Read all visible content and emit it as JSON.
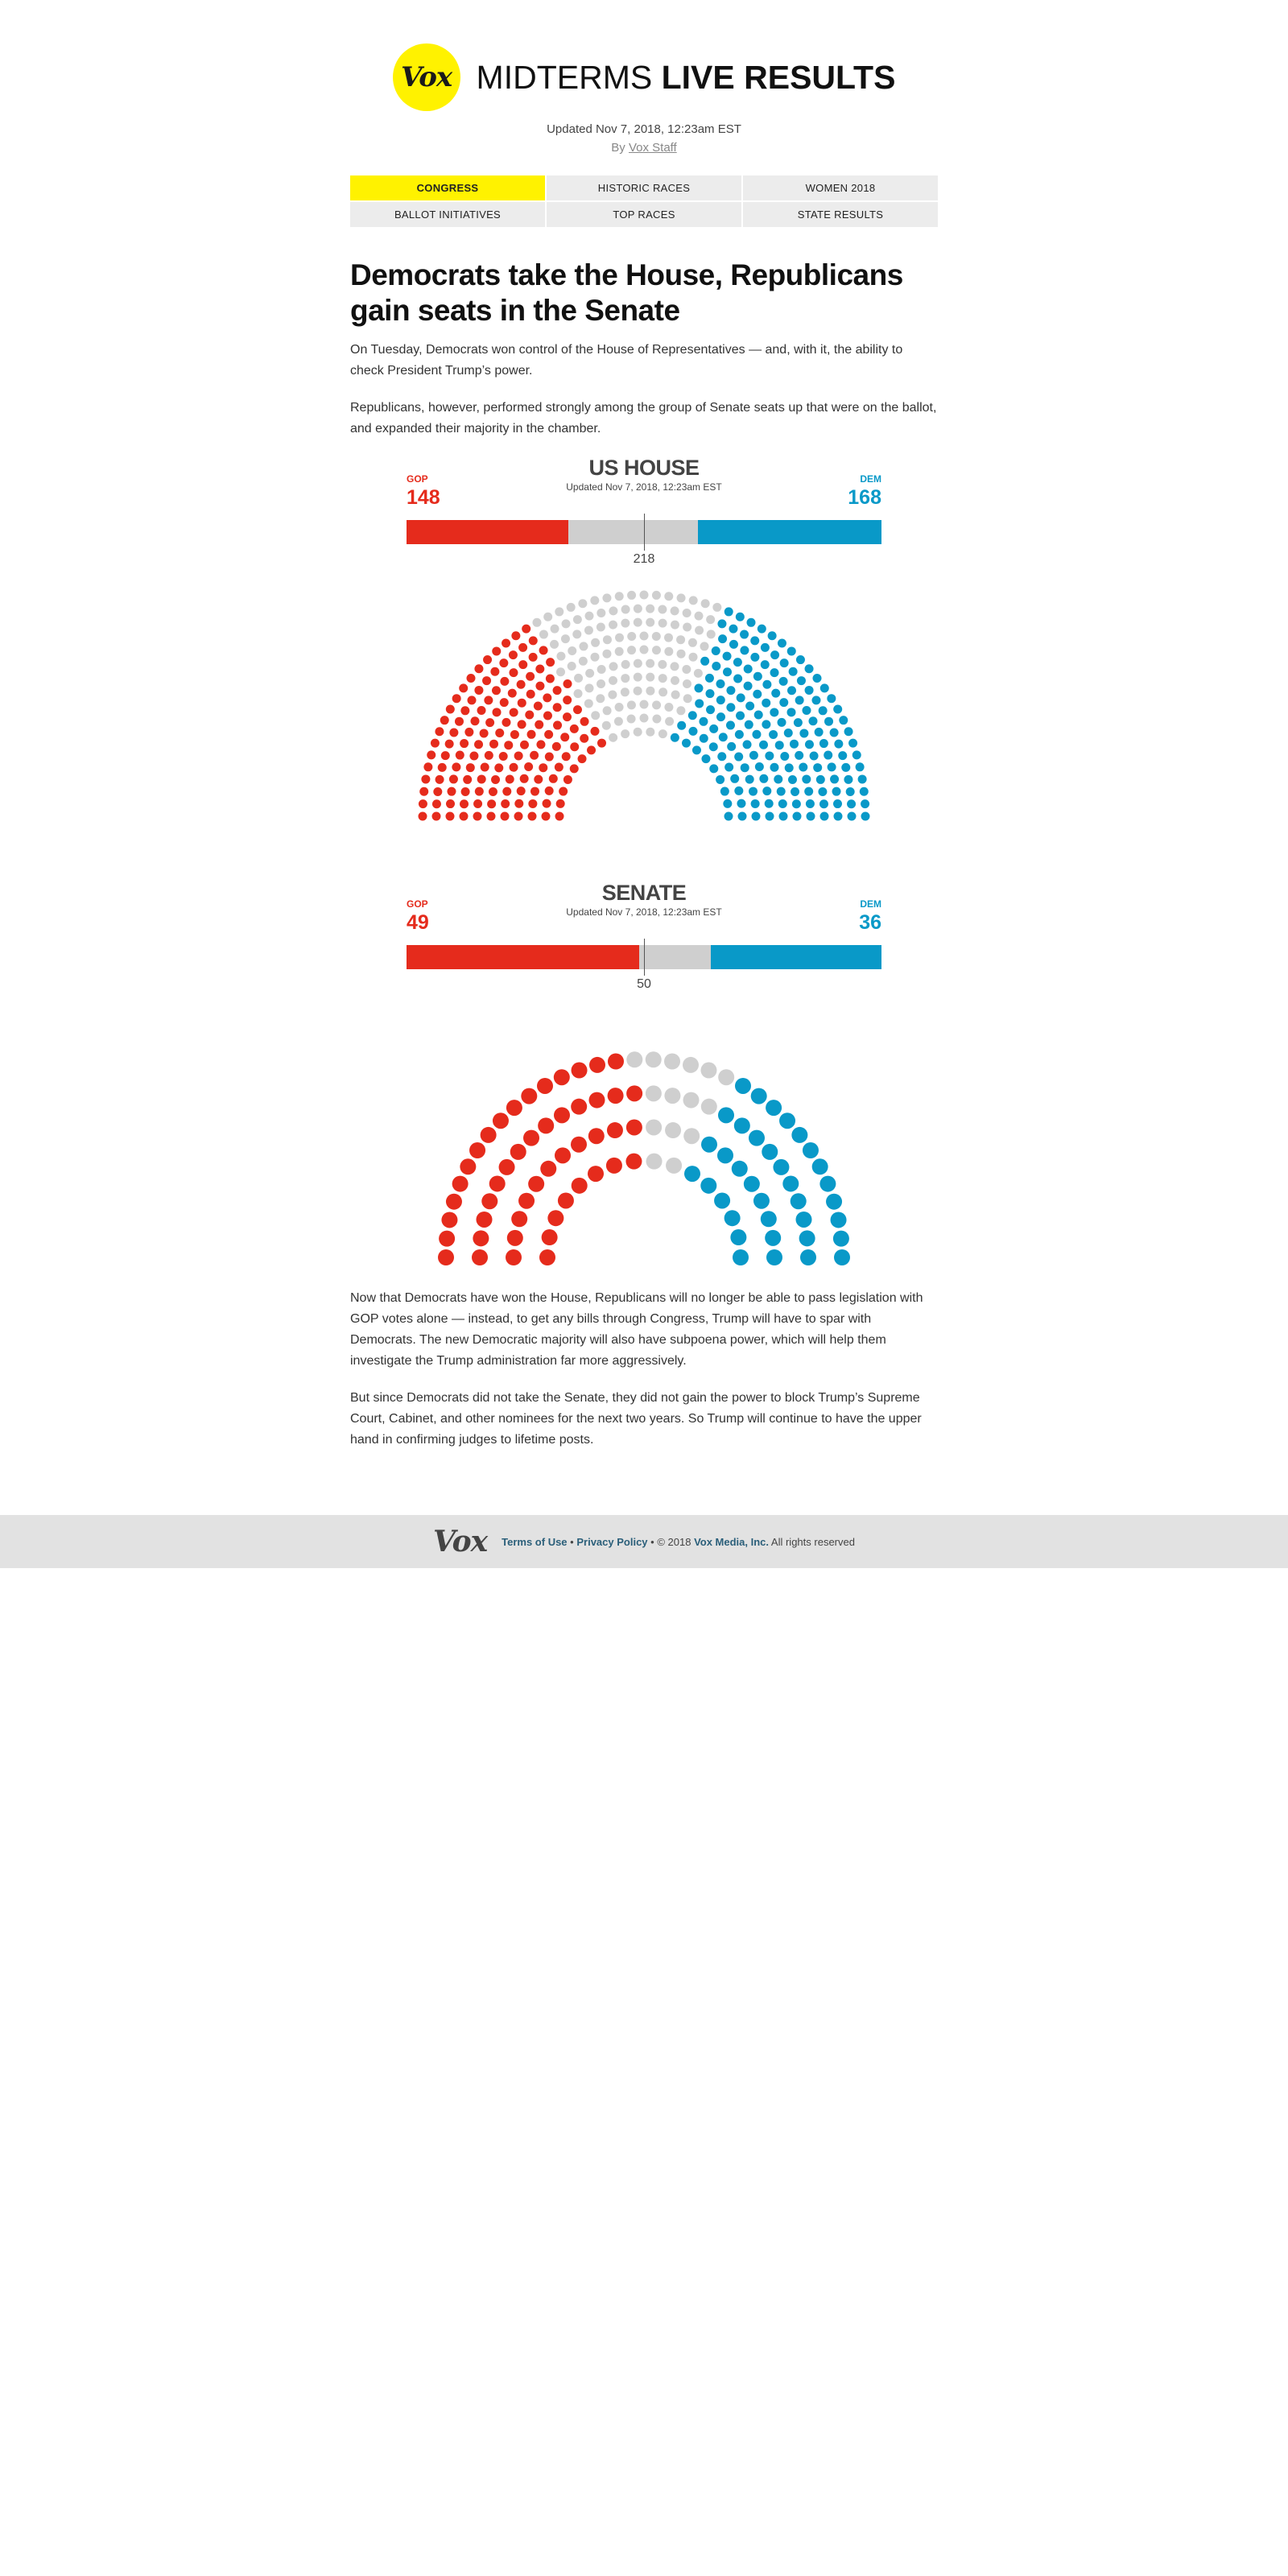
{
  "header": {
    "logo_text": "Vox",
    "title_thin": "MIDTERMS",
    "title_bold": "LIVE RESULTS",
    "updated": "Updated Nov 7, 2018, 12:23am EST",
    "byline_prefix": "By",
    "byline_author": "Vox Staff"
  },
  "tabs": [
    {
      "label": "CONGRESS",
      "active": true
    },
    {
      "label": "HISTORIC RACES",
      "active": false
    },
    {
      "label": "WOMEN 2018",
      "active": false
    },
    {
      "label": "BALLOT INITIATIVES",
      "active": false
    },
    {
      "label": "TOP RACES",
      "active": false
    },
    {
      "label": "STATE RESULTS",
      "active": false
    }
  ],
  "article": {
    "headline": "Democrats take the House, Republicans gain seats in the Senate",
    "intro_1": "On Tuesday, Democrats won control of the House of Representatives — and, with it, the ability to check President Trump’s power.",
    "intro_2": "Republicans, however, performed strongly among the group of Senate seats up that were on the ballot, and expanded their majority in the chamber.",
    "outro_1": "Now that Democrats have won the House, Republicans will no longer be able to pass legislation with GOP votes alone — instead, to get any bills through Congress, Trump will have to spar with Democrats. The new Democratic majority will also have subpoena power, which will help them investigate the Trump administration far more aggressively.",
    "outro_2": "But since Democrats did not take the Senate, they did not gain the power to block Trump’s Supreme Court, Cabinet, and other nominees for the next two years. So Trump will continue to have the upper hand in confirming judges to lifetime posts."
  },
  "colors": {
    "gop": "#e52b1c",
    "dem": "#0999c8",
    "undecided": "#cfcfcf",
    "accent": "#fff200"
  },
  "chart_data": [
    {
      "type": "hemicycle",
      "title": "US HOUSE",
      "updated": "Updated Nov 7, 2018, 12:23am EST",
      "gop_label": "GOP",
      "dem_label": "DEM",
      "gop": 148,
      "dem": 168,
      "total": 435,
      "threshold": 218
    },
    {
      "type": "hemicycle",
      "title": "SENATE",
      "updated": "Updated Nov 7, 2018, 12:23am EST",
      "gop_label": "GOP",
      "dem_label": "DEM",
      "gop": 49,
      "dem": 36,
      "total": 100,
      "threshold": 50
    }
  ],
  "footer": {
    "logo_text": "Vox",
    "terms": "Terms of Use",
    "separator": "•",
    "privacy": "Privacy Policy",
    "copyright_prefix": "• © 2018",
    "company": "Vox Media, Inc.",
    "rights": "All rights reserved"
  }
}
